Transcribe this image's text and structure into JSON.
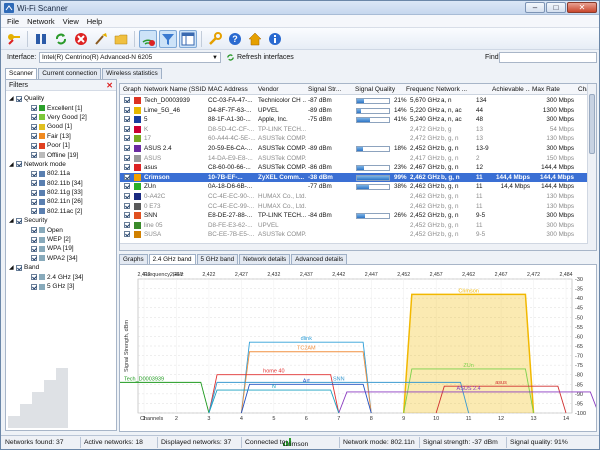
{
  "window": {
    "title": "Wi-Fi Scanner",
    "min": "–",
    "max": "□",
    "close": "✕"
  },
  "menu": [
    "File",
    "Network",
    "View",
    "Help"
  ],
  "interface": {
    "label": "Interface:",
    "value": "Intel(R) Centrino(R) Advanced-N 6205",
    "refresh_label": "Refresh interfaces",
    "find_label": "Find:"
  },
  "tabs_top": [
    "Scanner",
    "Current connection",
    "Wireless statistics"
  ],
  "filters": {
    "title": "Filters",
    "groups": [
      {
        "label": "Quality",
        "items": [
          {
            "label": "Excellent [1]",
            "color": "#2aa02a"
          },
          {
            "label": "Very Good [2]",
            "color": "#7dc83a"
          },
          {
            "label": "Good [1]",
            "color": "#e0c020"
          },
          {
            "label": "Fair [13]",
            "color": "#f08a20"
          },
          {
            "label": "Poor [1]",
            "color": "#e04020"
          },
          {
            "label": "Offline [19]",
            "color": "#bbbbbb"
          }
        ]
      },
      {
        "label": "Network mode",
        "items": [
          {
            "label": "802.11a",
            "color": "#5a7fb0"
          },
          {
            "label": "802.11b [34]",
            "color": "#5a7fb0"
          },
          {
            "label": "802.11g [33]",
            "color": "#5a7fb0"
          },
          {
            "label": "802.11n [26]",
            "color": "#5a7fb0"
          },
          {
            "label": "802.11ac [2]",
            "color": "#5a7fb0"
          }
        ]
      },
      {
        "label": "Security",
        "items": [
          {
            "label": "Open",
            "color": "#8ab"
          },
          {
            "label": "WEP [2]",
            "color": "#8ab"
          },
          {
            "label": "WPA [19]",
            "color": "#8ab"
          },
          {
            "label": "WPA2 [34]",
            "color": "#8ab"
          }
        ]
      },
      {
        "label": "Band",
        "items": [
          {
            "label": "2.4 GHz [34]",
            "color": "#8ab"
          },
          {
            "label": "5 GHz [3]",
            "color": "#8ab"
          }
        ]
      }
    ]
  },
  "table": {
    "columns": [
      "Graph",
      "Network Name (SSID)",
      "MAC Address",
      "Vendor",
      "Signal Str...",
      "Signal Quality",
      "Frequency",
      "Network ...",
      "",
      "Achievable ...",
      "Max Rate",
      "Chann..."
    ],
    "rows": [
      {
        "color": "#d32",
        "ssid": "Tech_D0003939",
        "mac": "CC-03-FA-47-...",
        "vendor": "Technicolor CH ...",
        "signal": "-87 dBm",
        "quality": 0.21,
        "qtext": "21%",
        "freq": "5,670 GHz",
        "mode": "a, n",
        "ch": "134",
        "ach": "",
        "max": "300 Mbps",
        "dim": false,
        "sel": false
      },
      {
        "color": "#e6b800",
        "ssid": "Lime_5G_46",
        "mac": "D4-8F-7F-63-...",
        "vendor": "UPVEL",
        "signal": "-89 dBm",
        "quality": 0.14,
        "qtext": "14%",
        "freq": "5,220 GHz",
        "mode": "a, n, ac",
        "ch": "44",
        "ach": "",
        "max": "1300 Mbps",
        "dim": false,
        "sel": false
      },
      {
        "color": "#1a3fa0",
        "ssid": "5",
        "mac": "88-1F-A1-30-...",
        "vendor": "Apple, Inc.",
        "signal": "-75 dBm",
        "quality": 0.41,
        "qtext": "41%",
        "freq": "5,240 GHz",
        "mode": "a, n, ac",
        "ch": "48",
        "ach": "",
        "max": "300 Mbps",
        "dim": false,
        "sel": false
      },
      {
        "color": "#c03",
        "ssid": "K",
        "mac": "D8-5D-4C-CF-...",
        "vendor": "TP-LINK TECH...",
        "signal": "",
        "quality": 0,
        "qtext": "",
        "freq": "2,472 GHz",
        "mode": "b, g",
        "ch": "13",
        "ach": "",
        "max": "54 Mbps",
        "dim": true,
        "sel": false
      },
      {
        "color": "#7a2",
        "ssid": "17",
        "mac": "60-A44-4C-5E-...",
        "vendor": "ASUSTek COMP...",
        "signal": "",
        "quality": 0,
        "qtext": "",
        "freq": "2,472 GHz",
        "mode": "b, g, n",
        "ch": "13",
        "ach": "",
        "max": "130 Mbps",
        "dim": true,
        "sel": false
      },
      {
        "color": "#6a2aa0",
        "ssid": "ASUS 2.4",
        "mac": "20-59-E6-CA-...",
        "vendor": "ASUSTek COMP...",
        "signal": "-89 dBm",
        "quality": 0.18,
        "qtext": "18%",
        "freq": "2,452 GHz",
        "mode": "b, g, n",
        "ch": "13-9",
        "ach": "",
        "max": "300 Mbps",
        "dim": false,
        "sel": false
      },
      {
        "color": "#999",
        "ssid": "ASUS",
        "mac": "14-DA-E9-E8-...",
        "vendor": "ASUSTek COMP...",
        "signal": "",
        "quality": 0,
        "qtext": "",
        "freq": "2,417 GHz",
        "mode": "b, g, n",
        "ch": "2",
        "ach": "",
        "max": "150 Mbps",
        "dim": true,
        "sel": false
      },
      {
        "color": "#d22",
        "ssid": "asus",
        "mac": "C8-60-00-66-...",
        "vendor": "ASUSTek COMP...",
        "signal": "-86 dBm",
        "quality": 0.23,
        "qtext": "23%",
        "freq": "2,467 GHz",
        "mode": "b, g, n",
        "ch": "12",
        "ach": "",
        "max": "144,4 Mbps",
        "dim": false,
        "sel": false
      },
      {
        "color": "#f4a000",
        "ssid": "Crimson",
        "mac": "10-7B-EF-...",
        "vendor": "ZyXEL Comm...",
        "signal": "-38 dBm",
        "quality": 0.99,
        "qtext": "99%",
        "freq": "2,462 GHz",
        "mode": "b, g, n",
        "ch": "11",
        "ach": "144,4 Mbps",
        "max": "144,4 Mbps",
        "dim": false,
        "sel": true
      },
      {
        "color": "#2ab02a",
        "ssid": "ZUn",
        "mac": "0A-18-D6-6B-...",
        "vendor": "",
        "signal": "-77 dBm",
        "quality": 0.38,
        "qtext": "38%",
        "freq": "2,462 GHz",
        "mode": "b, g, n",
        "ch": "11",
        "ach": "14,4 Mbps",
        "max": "144,4 Mbps",
        "dim": false,
        "sel": false
      },
      {
        "color": "#1a2a80",
        "ssid": "0-A42C",
        "mac": "CC-4E-EC-90-...",
        "vendor": "HUMAX Co., Ltd.",
        "signal": "",
        "quality": 0,
        "qtext": "",
        "freq": "2,462 GHz",
        "mode": "b, g, n",
        "ch": "11",
        "ach": "",
        "max": "130 Mbps",
        "dim": true,
        "sel": false
      },
      {
        "color": "#5a5a5a",
        "ssid": "0 E73",
        "mac": "CC-4E-EC-99-...",
        "vendor": "HUMAX Co., Ltd.",
        "signal": "",
        "quality": 0,
        "qtext": "",
        "freq": "2,462 GHz",
        "mode": "b, g, n",
        "ch": "11",
        "ach": "",
        "max": "130 Mbps",
        "dim": true,
        "sel": false
      },
      {
        "color": "#e05020",
        "ssid": "SNN",
        "mac": "E8-DE-27-88-...",
        "vendor": "TP-LINK TECH...",
        "signal": "-84 dBm",
        "quality": 0.26,
        "qtext": "26%",
        "freq": "2,452 GHz",
        "mode": "b, g, n",
        "ch": "9-5",
        "ach": "",
        "max": "300 Mbps",
        "dim": false,
        "sel": false
      },
      {
        "color": "#3a8a2a",
        "ssid": "line 05",
        "mac": "D8-FE-E3-62-...",
        "vendor": "UPVEL",
        "signal": "",
        "quality": 0,
        "qtext": "",
        "freq": "2,452 GHz",
        "mode": "b, g, n",
        "ch": "11",
        "ach": "",
        "max": "300 Mbps",
        "dim": true,
        "sel": false
      },
      {
        "color": "#d08000",
        "ssid": "SUSA",
        "mac": "BC-EE-7B-E5-...",
        "vendor": "ASUSTek COMP...",
        "signal": "",
        "quality": 0,
        "qtext": "",
        "freq": "2,452 GHz",
        "mode": "b, g, n",
        "ch": "9-5",
        "ach": "",
        "max": "300 Mbps",
        "dim": true,
        "sel": false
      }
    ]
  },
  "tabs_bottom": [
    "Graphs",
    "2.4 GHz band",
    "5 GHz band",
    "Network details",
    "Advanced details"
  ],
  "chart_data": {
    "type": "area",
    "xlabel": "Channels",
    "ylabel": "Signal Strength, dBm",
    "freq_label": "Frequency, GHz",
    "freq_ticks": [
      "2,412",
      "2,417",
      "2,422",
      "2,427",
      "2,432",
      "2,437",
      "2,442",
      "2,447",
      "2,452",
      "2,457",
      "2,462",
      "2,467",
      "2,472",
      "2,484"
    ],
    "channels": [
      1,
      2,
      3,
      4,
      5,
      6,
      7,
      8,
      9,
      10,
      11,
      12,
      13,
      14
    ],
    "ylim": [
      -100,
      -30
    ],
    "yticks": [
      -30,
      -35,
      -40,
      -45,
      -50,
      -55,
      -60,
      -65,
      -70,
      -75,
      -80,
      -85,
      -90,
      -95,
      -100
    ],
    "series": [
      {
        "name": "Crimson",
        "center": 11,
        "width": 20,
        "dbm": -38,
        "color": "#f2b800",
        "fill": true
      },
      {
        "name": "dlink",
        "center": 6,
        "width": 20,
        "dbm": -63,
        "color": "#2f9fd8"
      },
      {
        "name": "TC2AM",
        "center": 6,
        "width": 20,
        "dbm": -68,
        "color": "#f09040"
      },
      {
        "name": "home 40",
        "center": 5,
        "width": 20,
        "dbm": -80,
        "color": "#e03030"
      },
      {
        "name": "Tech_D0003939",
        "center": 1,
        "width": 20,
        "dbm": -84,
        "color": "#1f9a1f"
      },
      {
        "name": "ZUn",
        "center": 11,
        "width": 20,
        "dbm": -77,
        "color": "#7ad04a"
      },
      {
        "name": "Art",
        "center": 6,
        "width": 20,
        "dbm": -85,
        "color": "#2050c0"
      },
      {
        "name": "SNN",
        "center": 7,
        "width": 40,
        "dbm": -84,
        "color": "#3a9ad0"
      },
      {
        "name": "asus",
        "center": 12,
        "width": 20,
        "dbm": -86,
        "color": "#d03030"
      },
      {
        "name": "ASUS 2.4",
        "center": 11,
        "width": 40,
        "dbm": -89,
        "color": "#8a3ac0"
      },
      {
        "name": "N",
        "center": 5,
        "width": 20,
        "dbm": -88,
        "color": "#1aa0c0"
      }
    ]
  },
  "status": {
    "found": "Networks found: 37",
    "active": "Active networks: 18",
    "displayed": "Displayed networks: 37",
    "connected_label": "Connected to:",
    "connected_ssid": "Crimson",
    "mode": "Network mode: 802.11n",
    "strength": "Signal strength: -37 dBm",
    "quality": "Signal quality: 91%"
  }
}
